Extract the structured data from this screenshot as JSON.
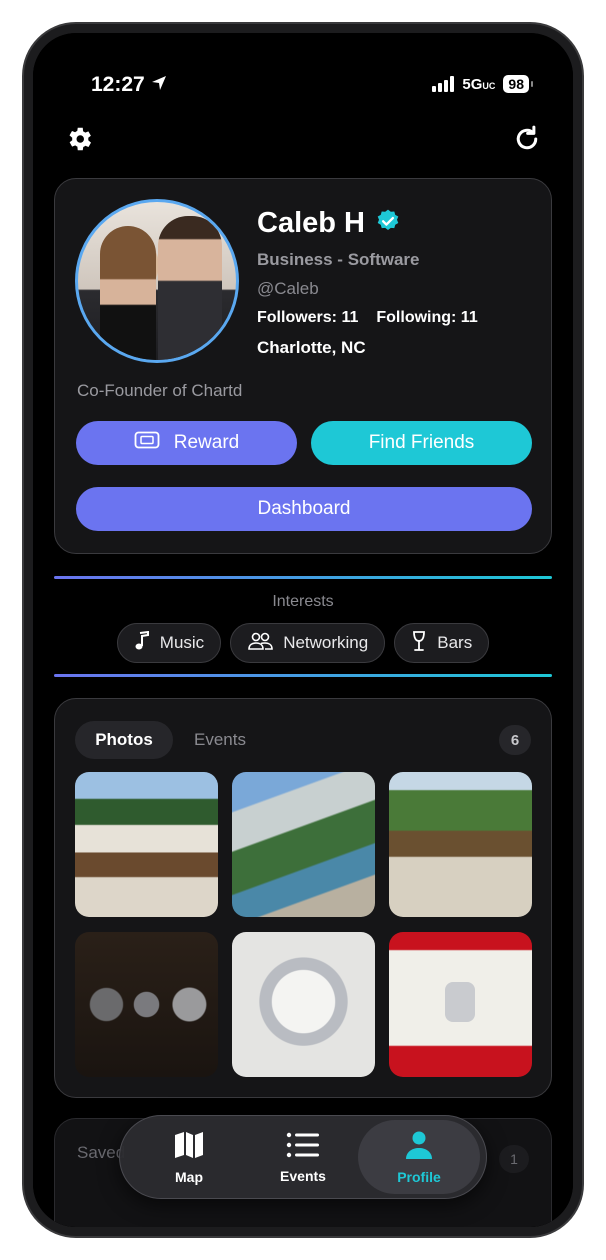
{
  "status": {
    "time": "12:27",
    "network": "5G",
    "network_suffix": "UC",
    "battery": "98"
  },
  "profile": {
    "name": "Caleb H",
    "category": "Business - Software",
    "handle": "@Caleb",
    "followers_label": "Followers: 11",
    "following_label": "Following: 11",
    "location": "Charlotte, NC",
    "bio": "Co-Founder of Chartd",
    "reward_label": "Reward",
    "find_friends_label": "Find Friends",
    "dashboard_label": "Dashboard"
  },
  "interests": {
    "title": "Interests",
    "chips": [
      {
        "label": "Music",
        "icon": "music-note-icon"
      },
      {
        "label": "Networking",
        "icon": "people-icon"
      },
      {
        "label": "Bars",
        "icon": "wine-glass-icon"
      }
    ]
  },
  "media": {
    "tabs": [
      "Photos",
      "Events"
    ],
    "active_tab": "Photos",
    "count": "6"
  },
  "saved": {
    "label": "Saved",
    "count": "1"
  },
  "tabbar": {
    "items": [
      {
        "label": "Map",
        "icon": "map-icon"
      },
      {
        "label": "Events",
        "icon": "list-icon"
      },
      {
        "label": "Profile",
        "icon": "person-icon"
      }
    ],
    "active": "Profile"
  },
  "colors": {
    "accent_purple": "#6b74f0",
    "accent_cyan": "#1ec8d6",
    "background": "#000000"
  }
}
